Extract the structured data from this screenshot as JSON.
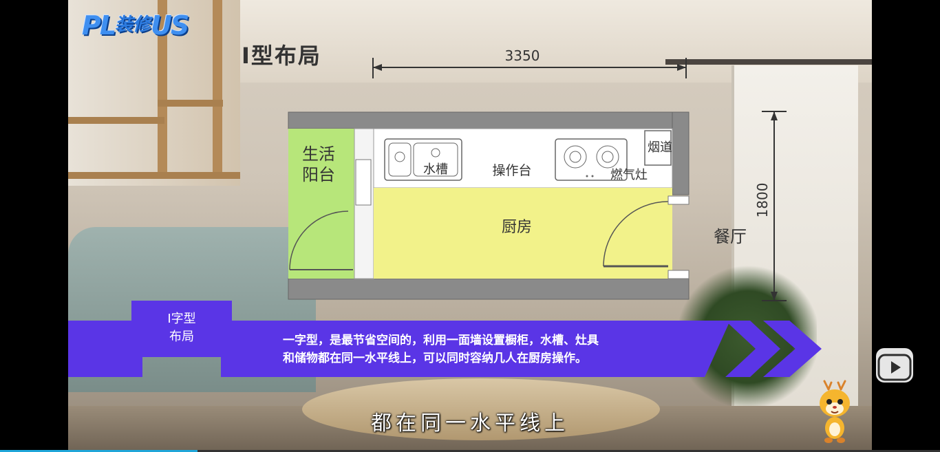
{
  "logo": {
    "text_left": "PL",
    "text_mid": "装修",
    "text_right": "US"
  },
  "layout_title": "I型布局",
  "plan": {
    "width_dim": "3350",
    "depth_dim": "1800",
    "rooms": {
      "balcony_line1": "生活",
      "balcony_line2": "阳台",
      "kitchen": "厨房",
      "dining": "餐厅"
    },
    "fixtures": {
      "sink": "水槽",
      "counter": "操作台",
      "stove": "燃气灶",
      "flue": "烟道"
    },
    "colors": {
      "balcony": "#b7e67a",
      "kitchen": "#f2f28a",
      "wall": "#8a8a8a"
    }
  },
  "banner": {
    "tab_line1": "I字型",
    "tab_line2": "布局",
    "description_line1": "一字型，是最节省空间的，利用一面墙设置橱柜，水槽、灶具",
    "description_line2": "和储物都在同一水平线上，可以同时容纳几人在厨房操作。",
    "color": "#5a35e6"
  },
  "subtitle": "都在同一水平线上",
  "progress": {
    "fraction": 0.21,
    "color": "#1fa6d9"
  },
  "icons": {
    "play_button": "bilibili-tv-icon",
    "mascot": "deer-mascot-icon"
  }
}
